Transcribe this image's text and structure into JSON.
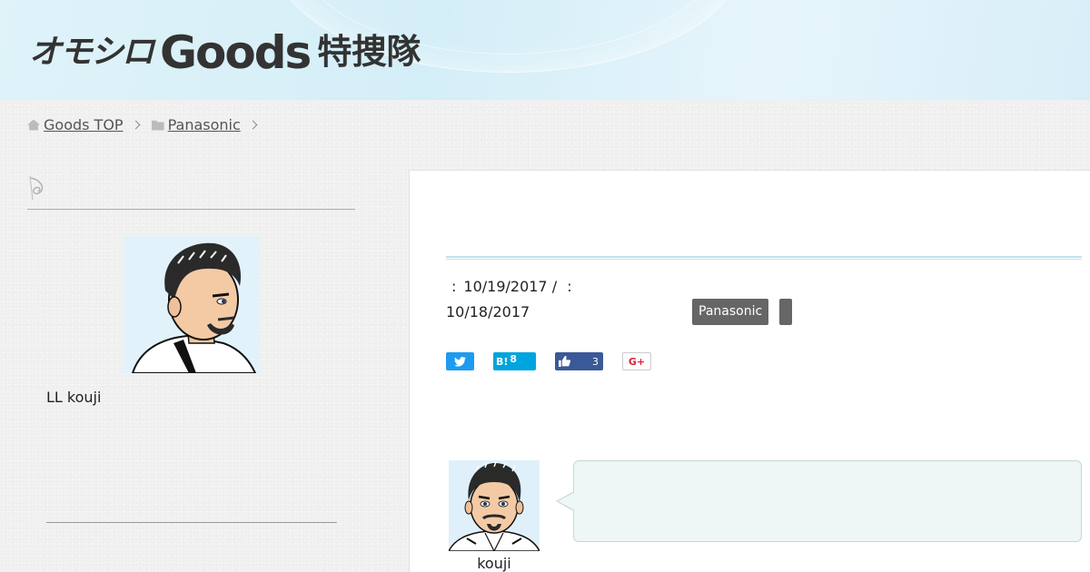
{
  "header": {
    "logo_part1": "オモシロ",
    "logo_part2": "Goods",
    "logo_part3": "特捜隊"
  },
  "breadcrumb": {
    "items": [
      {
        "label": "Goods TOP",
        "icon": "home-icon"
      },
      {
        "label": "Panasonic",
        "icon": "folder-icon"
      }
    ]
  },
  "sidebar": {
    "heading_icon": "spiral-icon",
    "profile_name": "LL kouji"
  },
  "article": {
    "meta_sep1": ":",
    "published": "10/19/2017",
    "meta_sep2": "/",
    "meta_sep3": ":",
    "updated": "10/18/2017",
    "tags": [
      "Panasonic",
      ""
    ],
    "share": {
      "twitter_icon": "twitter-icon",
      "hatena_label": "B!",
      "hatena_count": "8",
      "facebook_icon": "thumbs-up-icon",
      "facebook_count": "3",
      "google_label": "G+"
    }
  },
  "author": {
    "name": "kouji"
  },
  "colors": {
    "header_bg": "#d8eff8",
    "tag_bg": "#666666",
    "twitter": "#1d9bf0",
    "hatena": "#00a4de",
    "facebook": "#3b5998",
    "google": "#dd2233",
    "bubble_bg": "#eef6f6"
  }
}
